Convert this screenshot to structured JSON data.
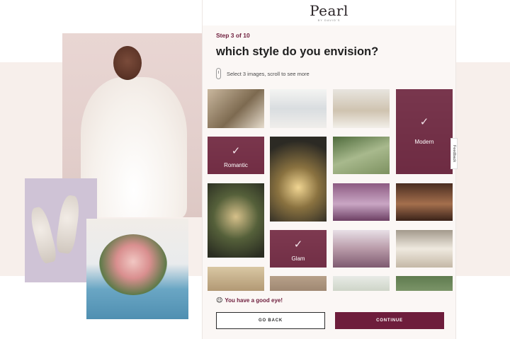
{
  "brand": {
    "logo_text": "Pearl",
    "logo_subtext": "BY DAVID'S",
    "accent_color": "#6e1d3c"
  },
  "quiz": {
    "step_label": "Step 3 of 10",
    "question": "which style do you envision?",
    "hint_icon": "scroll-icon",
    "hint": "Select 3 images, scroll to see more",
    "tiles": [
      {
        "label": "",
        "selected": false
      },
      {
        "label": "",
        "selected": false
      },
      {
        "label": "",
        "selected": false
      },
      {
        "label": "Modern",
        "selected": true
      },
      {
        "label": "Romantic",
        "selected": true
      },
      {
        "label": "",
        "selected": false
      },
      {
        "label": "",
        "selected": false
      },
      {
        "label": "",
        "selected": false
      },
      {
        "label": "",
        "selected": false
      },
      {
        "label": "Glam",
        "selected": true
      },
      {
        "label": "",
        "selected": false
      },
      {
        "label": "",
        "selected": false
      },
      {
        "label": "",
        "selected": false
      },
      {
        "label": "",
        "selected": false
      }
    ],
    "feedback_label": "Feedback",
    "encouragement": "You have a good eye!",
    "encouragement_emoji": "😉",
    "go_back_label": "GO BACK",
    "continue_label": "CONTINUE"
  }
}
